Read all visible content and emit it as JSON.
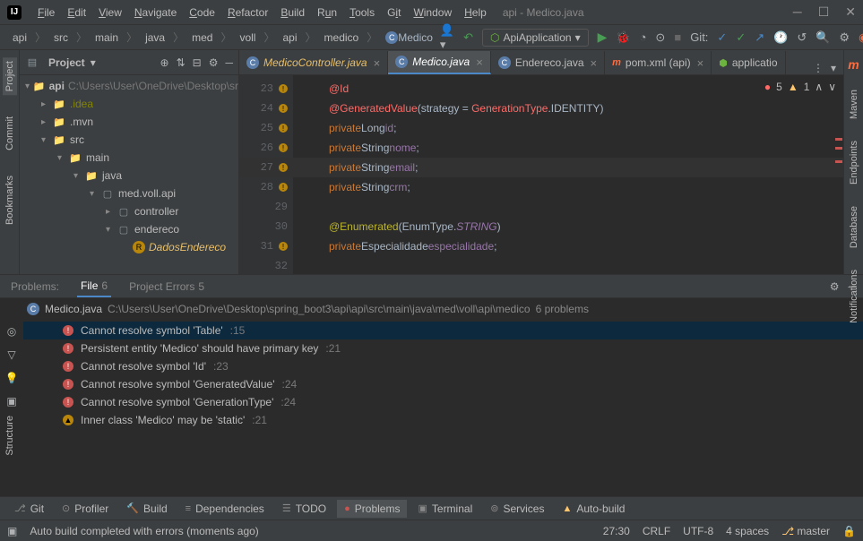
{
  "title": "api - Medico.java",
  "menu": [
    "File",
    "Edit",
    "View",
    "Navigate",
    "Code",
    "Refactor",
    "Build",
    "Run",
    "Tools",
    "Git",
    "Window",
    "Help"
  ],
  "breadcrumbs": [
    "api",
    "src",
    "main",
    "java",
    "med",
    "voll",
    "api",
    "medico"
  ],
  "breadcrumb_class": "Medico",
  "run_config": "ApiApplication",
  "git_label": "Git:",
  "project_panel": {
    "title": "Project"
  },
  "tree": {
    "root": {
      "name": "api",
      "path": "C:\\Users\\User\\OneDrive\\Desktop\\sr"
    },
    "idea": ".idea",
    "mvn": ".mvn",
    "src": "src",
    "main": "main",
    "java": "java",
    "pkg": "med.voll.api",
    "controller": "controller",
    "endereco": "endereco",
    "dados": "DadosEndereco"
  },
  "tabs": [
    {
      "label": "MedicoController.java"
    },
    {
      "label": "Medico.java"
    },
    {
      "label": "Endereco.java"
    },
    {
      "label": "pom.xml (api)"
    },
    {
      "label": "applicatio"
    }
  ],
  "inspector": {
    "errors": "5",
    "warnings": "1"
  },
  "code": {
    "lines": [
      {
        "n": "23",
        "t": ""
      },
      {
        "n": "24",
        "t": "@GeneratedValue"
      },
      {
        "n": "25",
        "t": "private Long id;"
      },
      {
        "n": "26",
        "t": "private String nome;"
      },
      {
        "n": "27",
        "t": "private String email;"
      },
      {
        "n": "28",
        "t": "private String crm;"
      },
      {
        "n": "29",
        "t": ""
      },
      {
        "n": "30",
        "t": "@Enumerated"
      },
      {
        "n": "31",
        "t": "private Especialidade especialidade;"
      },
      {
        "n": "32",
        "t": ""
      }
    ],
    "gv_strategy": "strategy",
    "gv_eq": " = ",
    "gv_gentype": "GenerationType",
    "gv_identity": ".IDENTITY",
    "enum_type": "EnumType",
    "enum_string": "STRING",
    "id_ann": "@Id"
  },
  "problems_tabs": {
    "problems": "Problems:",
    "file": "File",
    "file_count": "6",
    "project_errors": "Project Errors",
    "pe_count": "5"
  },
  "problems_header": {
    "file": "Medico.java",
    "path": "C:\\Users\\User\\OneDrive\\Desktop\\spring_boot3\\api\\api\\src\\main\\java\\med\\voll\\api\\medico",
    "count": "6 problems"
  },
  "problems": [
    {
      "type": "err",
      "msg": "Cannot resolve symbol 'Table'",
      "loc": ":15"
    },
    {
      "type": "err",
      "msg": "Persistent entity 'Medico' should have primary key",
      "loc": ":21"
    },
    {
      "type": "err",
      "msg": "Cannot resolve symbol 'Id'",
      "loc": ":23"
    },
    {
      "type": "err",
      "msg": "Cannot resolve symbol 'GeneratedValue'",
      "loc": ":24"
    },
    {
      "type": "err",
      "msg": "Cannot resolve symbol 'GenerationType'",
      "loc": ":24"
    },
    {
      "type": "warn",
      "msg": "Inner class 'Medico' may be 'static'",
      "loc": ":21"
    }
  ],
  "bottom_tabs": [
    "Git",
    "Profiler",
    "Build",
    "Dependencies",
    "TODO",
    "Problems",
    "Terminal",
    "Services",
    "Auto-build"
  ],
  "status": {
    "msg": "Auto build completed with errors (moments ago)",
    "pos": "27:30",
    "eol": "CRLF",
    "enc": "UTF-8",
    "indent": "4 spaces",
    "branch": "master"
  },
  "right_tools": [
    "Maven",
    "Endpoints",
    "Database",
    "Notifications"
  ]
}
